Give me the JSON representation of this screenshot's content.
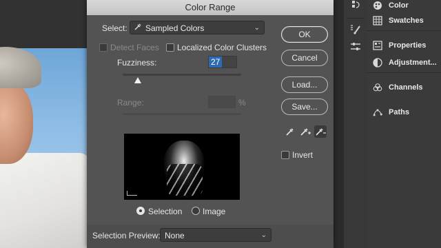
{
  "dialog": {
    "title": "Color Range",
    "select_label": "Select:",
    "select_value": "Sampled Colors",
    "detect_faces_label": "Detect Faces",
    "localized_label": "Localized Color Clusters",
    "fuzziness_label": "Fuzziness:",
    "fuzziness_value": "27",
    "range_label": "Range:",
    "range_unit": "%",
    "selection_radio": "Selection",
    "image_radio": "Image",
    "preview_label": "Selection Preview:",
    "preview_value": "None"
  },
  "buttons": {
    "ok": "OK",
    "cancel": "Cancel",
    "load": "Load...",
    "save": "Save..."
  },
  "invert_label": "Invert",
  "panels": {
    "color": "Color",
    "swatches": "Swatches",
    "properties": "Properties",
    "adjustments": "Adjustment...",
    "channels": "Channels",
    "paths": "Paths"
  },
  "colors": {
    "dialog_bg": "#535353",
    "accent": "#2d6ab0"
  }
}
